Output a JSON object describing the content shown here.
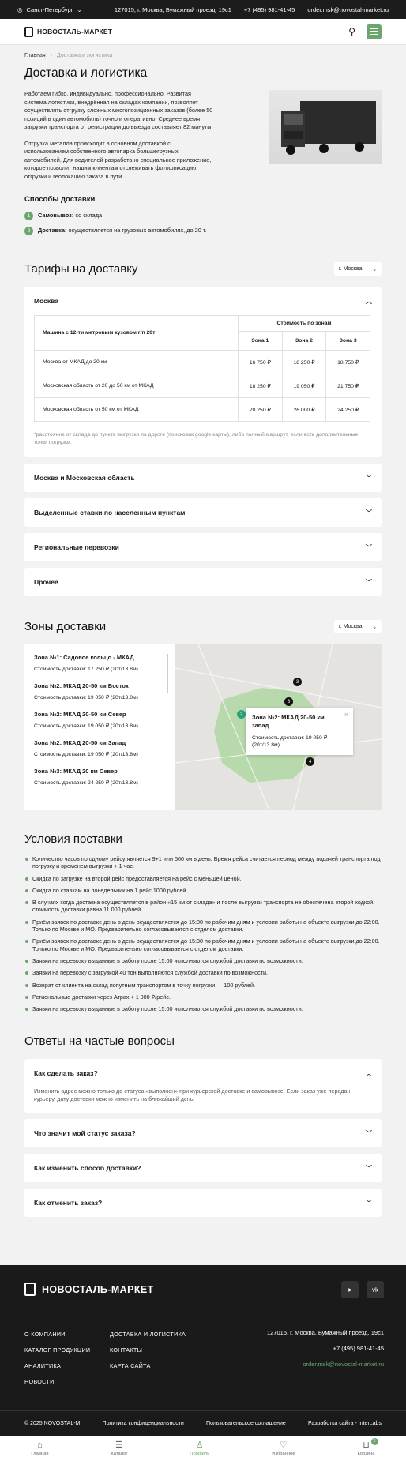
{
  "topbar": {
    "city": "Санкт-Петербург",
    "address": "127015, г. Москва, Бумажный проезд, 19с1",
    "phone": "+7 (495) 981-41-45",
    "email": "order.msk@novostal-market.ru"
  },
  "header": {
    "logo": "НОВОСТАЛЬ-МАРКЕТ"
  },
  "breadcrumb": [
    "Главная",
    "Доставка и логистика"
  ],
  "page_title": "Доставка и логистика",
  "intro": {
    "p1": "Работаем гибко, индивидуально, профессионально. Развитая система логистики, внедрённая на складах компании, позволяет осуществлять отгрузку сложных многопозиционных заказов (более 50 позиций в один автомобиль) точно и оперативно. Среднее время загрузки транспорта от регистрации до выезда составляет 82 минуты.",
    "p2": "Отгрузка металла происходит в основном доставкой с использованием собственного автопарка большегрузных автомобилей. Для водителей разработано специальное приложение, которое позволит нашим клиентам отслеживать фотофиксацию отгрузки и геолокацию заказа в пути."
  },
  "methods": {
    "title": "Способы доставки",
    "items": [
      {
        "num": "1",
        "bold": "Самовывоз:",
        "text": " со склада"
      },
      {
        "num": "2",
        "bold": "Доставка:",
        "text": " осуществляется на грузовых автомобилях, до 20 т."
      }
    ]
  },
  "tariffs": {
    "title": "Тарифы на доставку",
    "select": "г. Москва",
    "open_title": "Москва",
    "table": {
      "head_left": "Машина с 12-ти метровым кузовом г/п 20т",
      "head_group": "Стоимость по зонам",
      "zones": [
        "Зона 1",
        "Зона 2",
        "Зона 3"
      ],
      "rows": [
        {
          "name": "Москва от МКАД до 20 км",
          "vals": [
            "16 750 ₽",
            "18 250 ₽",
            "18 750 ₽"
          ]
        },
        {
          "name": "Московская область от 20 до 50 км от МКАД",
          "vals": [
            "18 250 ₽",
            "19 050 ₽",
            "21 750 ₽"
          ]
        },
        {
          "name": "Московская область от 50 км от МКАД",
          "vals": [
            "20 250 ₽",
            "26 000 ₽",
            "24 250 ₽"
          ]
        }
      ]
    },
    "note": "*расстояние от склада до пункта выгрузки по дороге (поисковик google карты), либо полный маршрут, если есть дополнительные точки погрузки.",
    "collapsed": [
      "Москва и Московская область",
      "Выделенные ставки по населенным пунктам",
      "Региональные перевозки",
      "Прочее"
    ]
  },
  "zones": {
    "title": "Зоны доставки",
    "select": "г. Москва",
    "items": [
      {
        "title": "Зона №1: Садовое кольцо - МКАД",
        "price": "Стоимость доставки: 17 250 ₽ (20т/13.8м)"
      },
      {
        "title": "Зона №2: МКАД 20-50 км Восток",
        "price": "Стоимость доставки: 19 050 ₽ (20т/13.8м)"
      },
      {
        "title": "Зона №2: МКАД 20-50 км Север",
        "price": "Стоимость доставки: 19 050 ₽ (20т/13.8м)"
      },
      {
        "title": "Зона №2: МКАД 20-50 км Запад",
        "price": "Стоимость доставки: 19 050 ₽ (20т/13.8м)"
      },
      {
        "title": "Зона №3: МКАД 20 км Север",
        "price": "Стоимость доставки: 24 250 ₽ (20т/13.8м)"
      }
    ],
    "popup": {
      "title": "Зона №2: МКАД 20-50 км запад",
      "price": "Стоимость доставки: 19 050 ₽ (20т/13.8м)"
    },
    "markers": [
      "2",
      "3",
      "3",
      "4"
    ]
  },
  "conditions": {
    "title": "Условия поставки",
    "items": [
      "Количество часов по одному рейсу является 9+1 или 500 км в день. Время рейса считается период между подачей транспорта под погрузку и временем выгрузки + 1 час.",
      "Скидка по загрузке на второй рейс предоставляется на рейс с меньшей ценой.",
      "Скидка по ставкам на понедельник на 1 рейс 1000 рублей.",
      "В случаях когда доставка осуществляется в район «15 км от склада» и после выгрузки транспорта не обеспечена второй ходкой, стоимость доставки равна 11 000 рублей.",
      "Приём заявок по доставке день в день осуществляется до 15:00 по рабочим дням и условии работы на объекте выгрузки до 22:00. Только по Москве и МО. Предварительно согласовывается с отделом доставки.",
      "Приём заявок по доставке день в день осуществляется до 15:00 по рабочим дням и условии работы на объекте выгрузки до 22:00. Только по Москве и МО. Предварительно согласовывается с отделом доставки.",
      "Заявки на перевозку выданные в работу после 15:00 исполняются службой доставки по возможности.",
      "Заявки на перевозку с загрузкой 40 тон выполняются службой доставки по возможности.",
      "Возврат от клиента на склад попутным транспортом в точку погрузки — 100 рублей.",
      "Региональные доставки через Атрах + 1 000 ₽/рейс.",
      "Заявки на перевозку выданные в работу после 15:00 исполняются службой доставки по возможности."
    ]
  },
  "faq": {
    "title": "Ответы на частые вопросы",
    "open": {
      "q": "Как сделать заказ?",
      "a": "Изменить адрес можно только до статуса «выполнен» при курьерской доставке и самовывозе. Если заказ уже передан курьеру, дату доставки можно изменить на ближайший день."
    },
    "collapsed": [
      "Что значит мой статус заказа?",
      "Как изменить способ доставки?",
      "Как отменить заказ?"
    ]
  },
  "footer": {
    "logo": "НОВОСТАЛЬ-МАРКЕТ",
    "col1": [
      "О КОМПАНИИ",
      "КАТАЛОГ ПРОДУКЦИИ",
      "АНАЛИТИКА",
      "НОВОСТИ"
    ],
    "col2": [
      "ДОСТАВКА И ЛОГИСТИКА",
      "КОНТАКТЫ",
      "КАРТА САЙТА"
    ],
    "address": "127015, г. Москва, Бумажный проезд, 19с1",
    "phone": "+7 (495) 981-41-45",
    "email": "order.msk@novostal-market.ru",
    "copyright": "© 2025 NOVOSTAL-M",
    "privacy": "Политика конфиденциальности",
    "terms": "Пользовательское соглашение",
    "dev": "Разработка сайта - InterLabs"
  },
  "tabbar": [
    {
      "label": "Главная",
      "icon": "⌂"
    },
    {
      "label": "Каталог",
      "icon": "☰"
    },
    {
      "label": "Профиль",
      "icon": "♙"
    },
    {
      "label": "Избранное",
      "icon": "♡"
    },
    {
      "label": "Корзина",
      "icon": "⊔",
      "badge": "2"
    }
  ],
  "colors": {
    "accent": "#6aa66e",
    "dark": "#1a1a1a"
  }
}
